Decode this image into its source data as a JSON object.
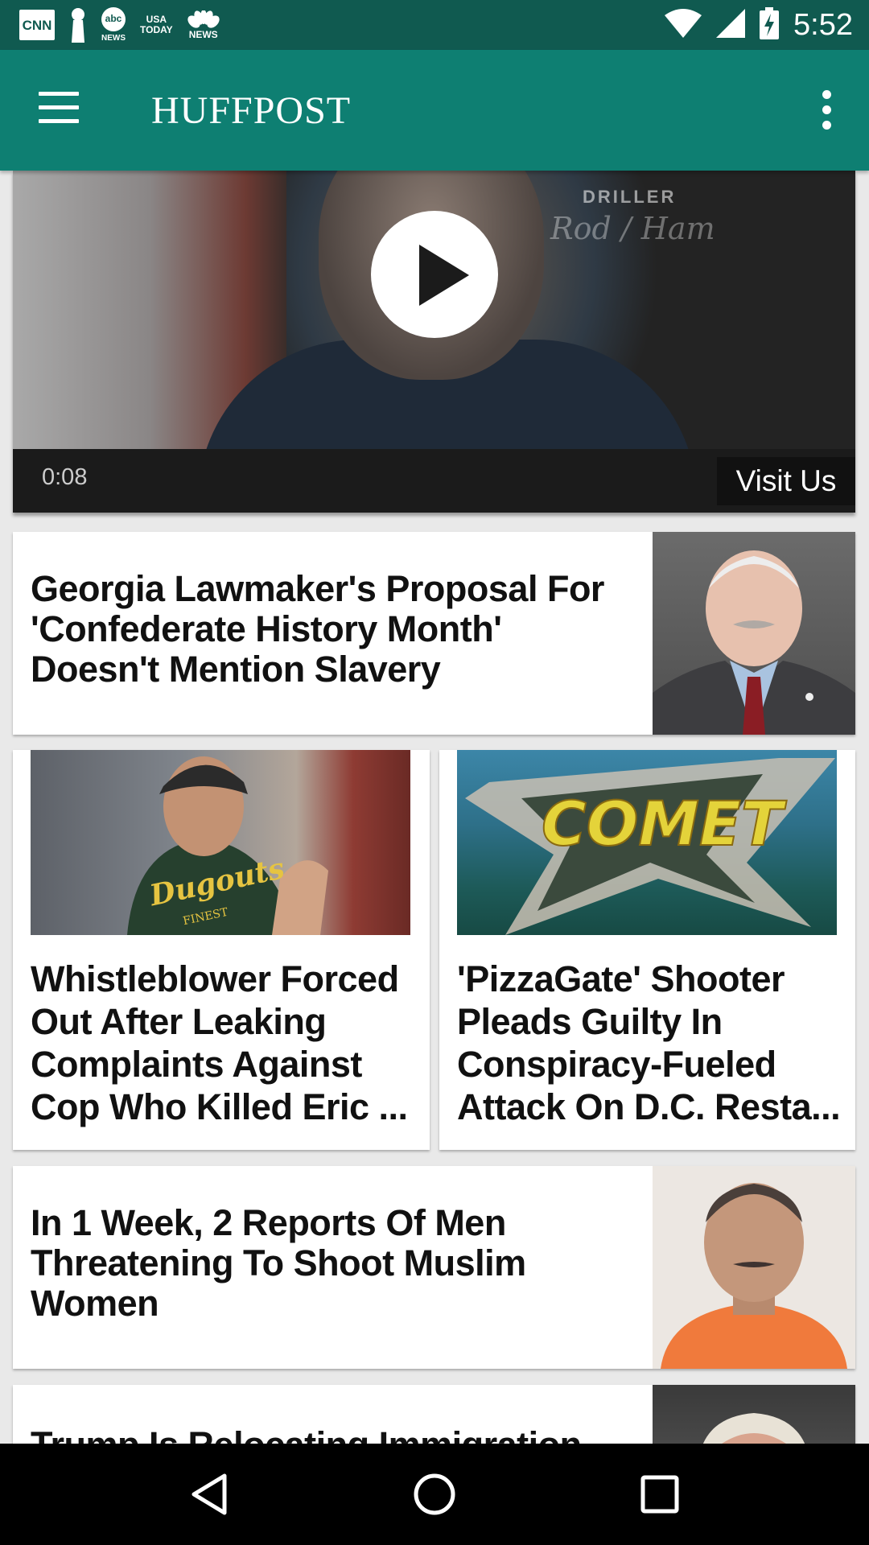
{
  "status_bar": {
    "time": "5:52",
    "notification_icons": [
      "cnn-icon",
      "keyhole-icon",
      "abc-news-icon",
      "usa-today-icon",
      "nbc-news-icon"
    ],
    "labels": {
      "cnn": "CNN",
      "abc": "abc",
      "abc_sub": "NEWS",
      "usa": "USA",
      "usa_sub": "TODAY",
      "nbc_sub": "NEWS"
    }
  },
  "app_bar": {
    "title": "HUFFPOST",
    "color": "#0e7f72"
  },
  "video": {
    "time": "0:08",
    "cta_label": "Visit Us",
    "watermark": "DRILLER",
    "watermark_signature": "Rod / Ham"
  },
  "articles": [
    {
      "headline": "Georgia Lawmaker's Proposal For 'Confederate History Month' Doesn't Mention Slavery",
      "layout": "wide"
    },
    {
      "headline": "Whistleblower Forced Out After Leaking Complaints Against Cop Who Killed Eric ...",
      "layout": "half",
      "image_text": "Dugouts",
      "image_subtext": "FINEST"
    },
    {
      "headline": "'PizzaGate' Shooter Pleads Guilty In Conspiracy-Fueled Attack On D.C. Resta...",
      "layout": "half",
      "image_text": "COMET"
    },
    {
      "headline": "In 1 Week, 2 Reports Of Men Threatening To Shoot Muslim Women",
      "layout": "wide"
    },
    {
      "headline": "Trump Is Relocating Immigration",
      "layout": "wide"
    }
  ],
  "nav_bar": {
    "buttons": [
      "back-icon",
      "home-icon",
      "recents-icon"
    ]
  }
}
